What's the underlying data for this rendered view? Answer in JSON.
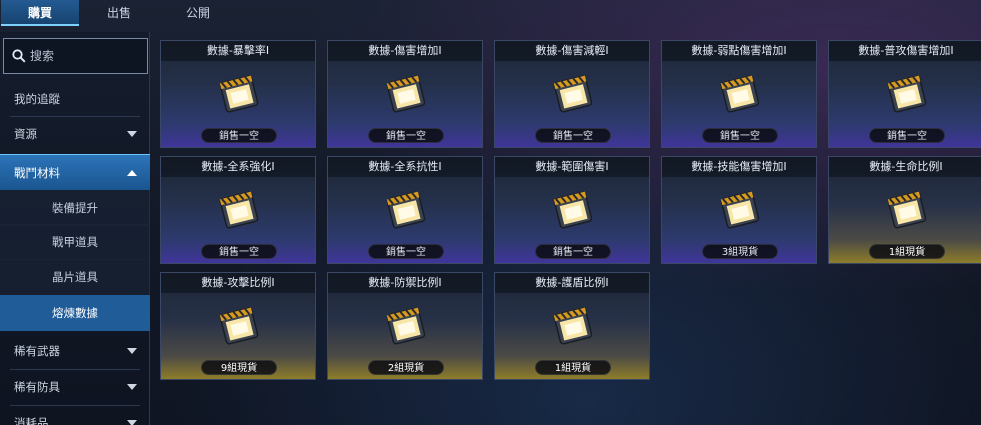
{
  "tabs": [
    {
      "label": "購買",
      "active": true
    },
    {
      "label": "出售",
      "active": false
    },
    {
      "label": "公開",
      "active": false
    }
  ],
  "search": {
    "placeholder": "搜索",
    "icon": "search-icon"
  },
  "sidebar": {
    "items": [
      {
        "label": "我的追蹤"
      },
      {
        "label": "資源",
        "chevron": "down"
      },
      {
        "label": "戰鬥材料",
        "chevron": "up",
        "expanded": true
      },
      {
        "label": "裝備提升"
      },
      {
        "label": "戰甲道具"
      },
      {
        "label": "晶片道具"
      },
      {
        "label": "熔煉數據",
        "selected": true
      },
      {
        "label": "稀有武器",
        "chevron": "down"
      },
      {
        "label": "稀有防具",
        "chevron": "down"
      },
      {
        "label": "消耗品",
        "chevron": "down"
      }
    ]
  },
  "items": [
    {
      "title": "數據-暴擊率I",
      "status": "銷售一空",
      "in_stock": false
    },
    {
      "title": "數據-傷害增加I",
      "status": "銷售一空",
      "in_stock": false
    },
    {
      "title": "數據-傷害減輕I",
      "status": "銷售一空",
      "in_stock": false
    },
    {
      "title": "數據-弱點傷害增加I",
      "status": "銷售一空",
      "in_stock": false
    },
    {
      "title": "數據-普攻傷害增加I",
      "status": "銷售一空",
      "in_stock": false
    },
    {
      "title": "數據-全系強化I",
      "status": "銷售一空",
      "in_stock": false
    },
    {
      "title": "數據-全系抗性I",
      "status": "銷售一空",
      "in_stock": false
    },
    {
      "title": "數據-範圍傷害I",
      "status": "銷售一空",
      "in_stock": false
    },
    {
      "title": "數據-技能傷害增加I",
      "status": "3組現貨",
      "in_stock": true
    },
    {
      "title": "數據-生命比例I",
      "status": "1組現貨",
      "in_stock": true
    },
    {
      "title": "數據-攻擊比例I",
      "status": "9組現貨",
      "in_stock": true
    },
    {
      "title": "數據-防禦比例I",
      "status": "2組現貨",
      "in_stock": true
    },
    {
      "title": "數據-護盾比例I",
      "status": "1組現貨",
      "in_stock": true
    }
  ],
  "colors": {
    "accent": "#1f5c98",
    "sold_out_glow": "#40359a",
    "in_stock_glow": "#8e7d2a"
  }
}
